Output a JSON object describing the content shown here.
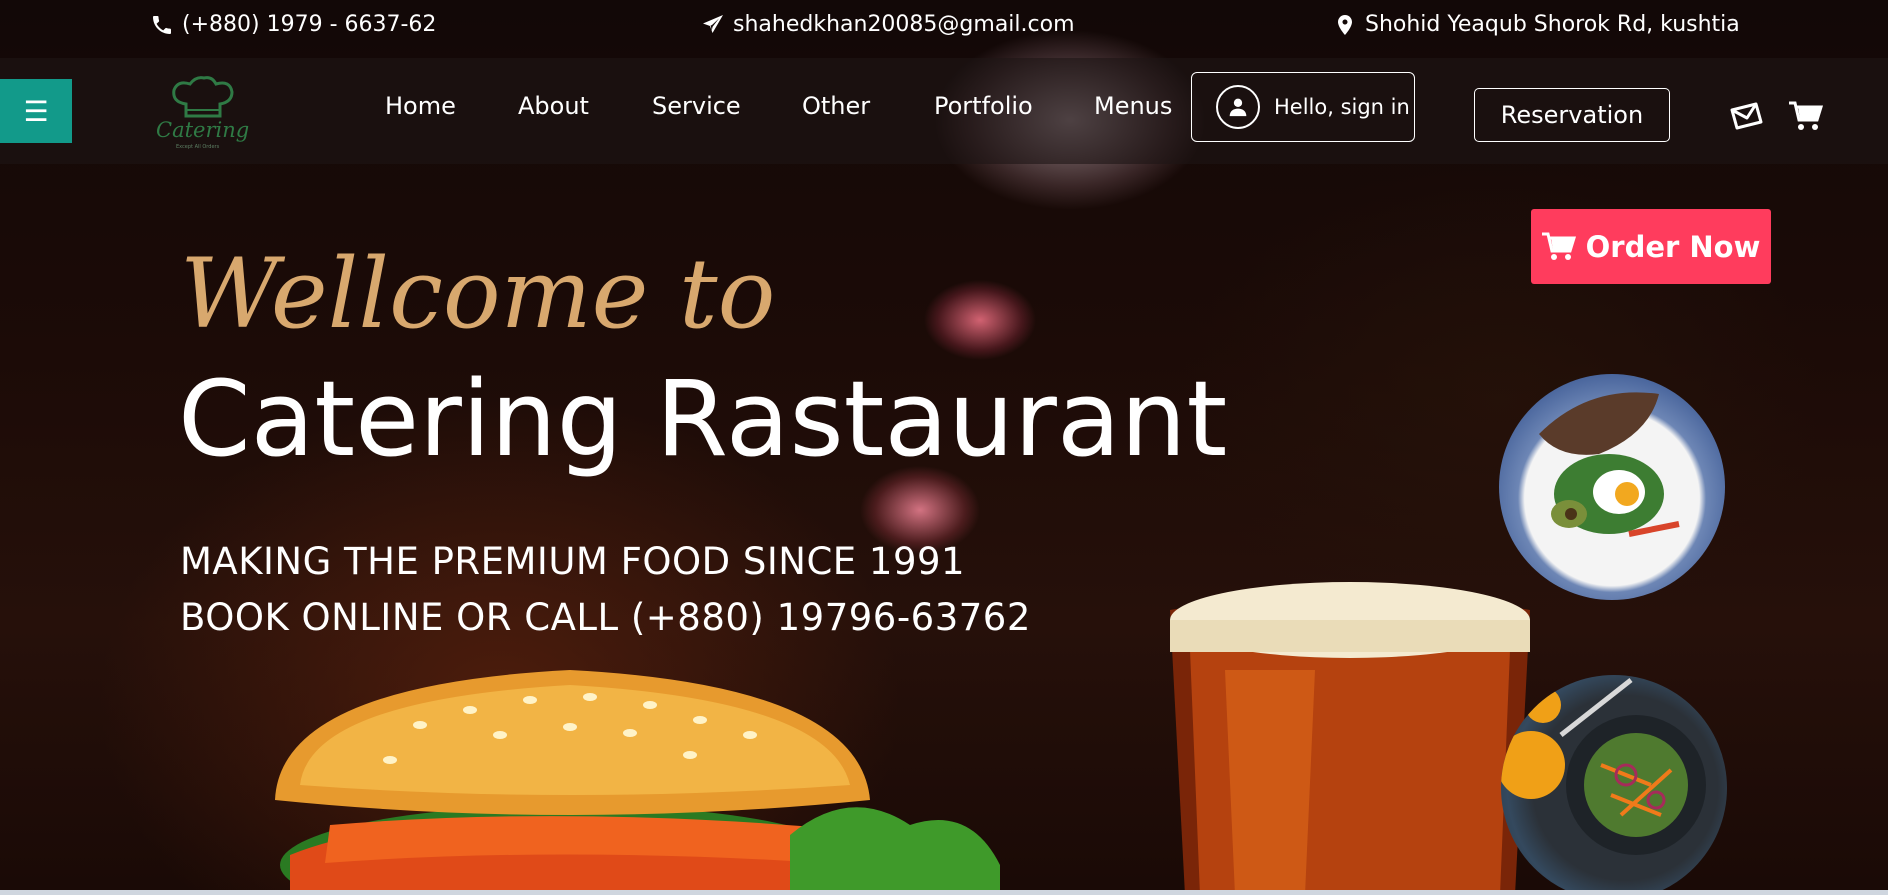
{
  "contact": {
    "phone": "(+880) 1979 - 6637-62",
    "email": "shahedkhan20085@gmail.com",
    "address": "Shohid Yeaqub Shorok Rd, kushtia"
  },
  "logo": {
    "text": "Catering",
    "subtext": "Except All Orders"
  },
  "nav": {
    "menu_icon": "☰",
    "links": [
      "Home",
      "About",
      "Service",
      "Other",
      "Portfolio",
      "Menus"
    ],
    "signin_label": "Hello, sign in",
    "reservation_label": "Reservation"
  },
  "hero": {
    "order_label": "Order Now",
    "welcome": "Wellcome to",
    "title": "Catering Rastaurant",
    "line1": "MAKING THE PREMIUM FOOD SINCE 1991",
    "line2": "BOOK ONLINE OR CALL (+880) 19796-63762"
  },
  "colors": {
    "menu_toggle": "#129a8a",
    "order_button": "#ff3c5d",
    "welcome_text": "#d8a86e"
  },
  "icons": [
    "phone-icon",
    "paper-plane-icon",
    "map-pin-icon",
    "user-icon",
    "envelope-icon",
    "cart-icon"
  ]
}
